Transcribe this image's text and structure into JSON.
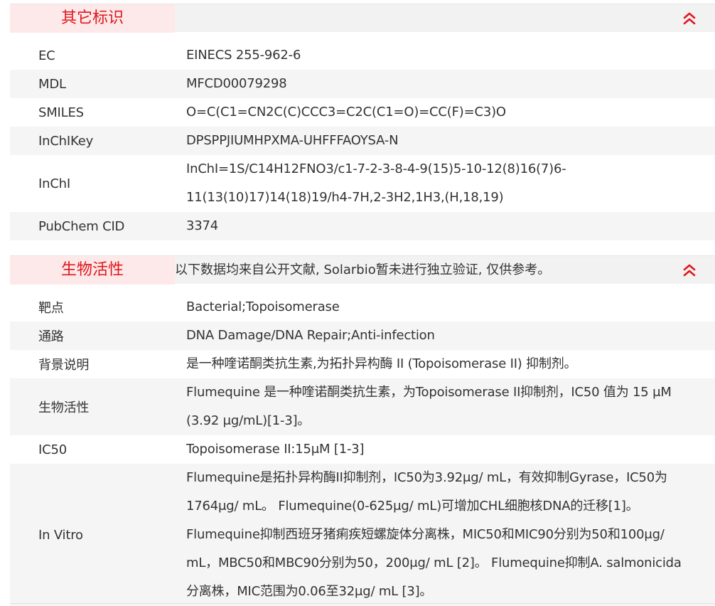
{
  "sections": [
    {
      "title": "其它标识",
      "note": "",
      "rows": [
        {
          "label": "EC",
          "value": [
            "EINECS 255-962-6"
          ]
        },
        {
          "label": "MDL",
          "value": [
            "MFCD00079298"
          ]
        },
        {
          "label": "SMILES",
          "value": [
            "O=C(C1=CN2C(C)CCC3=C2C(C1=O)=CC(F)=C3)O"
          ]
        },
        {
          "label": "InChIKey",
          "value": [
            "DPSPPJIUMHPXMA-UHFFFAOYSA-N"
          ]
        },
        {
          "label": "InChI",
          "value": [
            "InChI=1S/C14H12FNO3/c1-7-2-3-8-4-9(15)5-10-12(8)16(7)6-",
            "11(13(10)17)14(18)19/h4-7H,2-3H2,1H3,(H,18,19)"
          ]
        },
        {
          "label": "PubChem CID",
          "value": [
            "3374"
          ]
        }
      ]
    },
    {
      "title": "生物活性",
      "note": "以下数据均来自公开文献, Solarbio暂未进行独立验证, 仅供参考。",
      "rows": [
        {
          "label": "靶点",
          "value": [
            "Bacterial;Topoisomerase"
          ]
        },
        {
          "label": "通路",
          "value": [
            "DNA Damage/DNA Repair;Anti-infection"
          ]
        },
        {
          "label": "背景说明",
          "value": [
            "是一种喹诺酮类抗生素,为拓扑异构酶 II (Topoisomerase II) 抑制剂。"
          ]
        },
        {
          "label": "生物活性",
          "value": [
            "Flumequine 是一种喹诺酮类抗生素，为Topoisomerase II抑制剂，IC50 值为 15 μM",
            "(3.92 μg/mL)[1-3]。"
          ]
        },
        {
          "label": "IC50",
          "value": [
            "Topoisomerase II:15μM [1-3]"
          ]
        },
        {
          "label": "In Vitro",
          "value": [
            "Flumequine是拓扑异构酶II抑制剂，IC50为3.92μg/ mL，有效抑制Gyrase，IC50为",
            "1764μg/ mL。 Flumequine(0-625μg/ mL)可增加CHL细胞核DNA的迁移[1]。",
            "Flumequine抑制西班牙猪痢疾短螺旋体分离株，MIC50和MIC90分别为50和100μg/",
            "mL，MBC50和MBC90分别为50，200μg/ mL [2]。 Flumequine抑制A. salmonicida",
            "分离株，MIC范围为0.06至32μg/ mL [3]。"
          ]
        }
      ]
    }
  ],
  "colors": {
    "accent": "#e0171c",
    "tab_bg": "#fde9e9",
    "header_bg": "#f2f2f2",
    "alt_row_bg": "#f5f5f5"
  },
  "icons": {
    "collapse": "double-chevron-up-icon"
  }
}
